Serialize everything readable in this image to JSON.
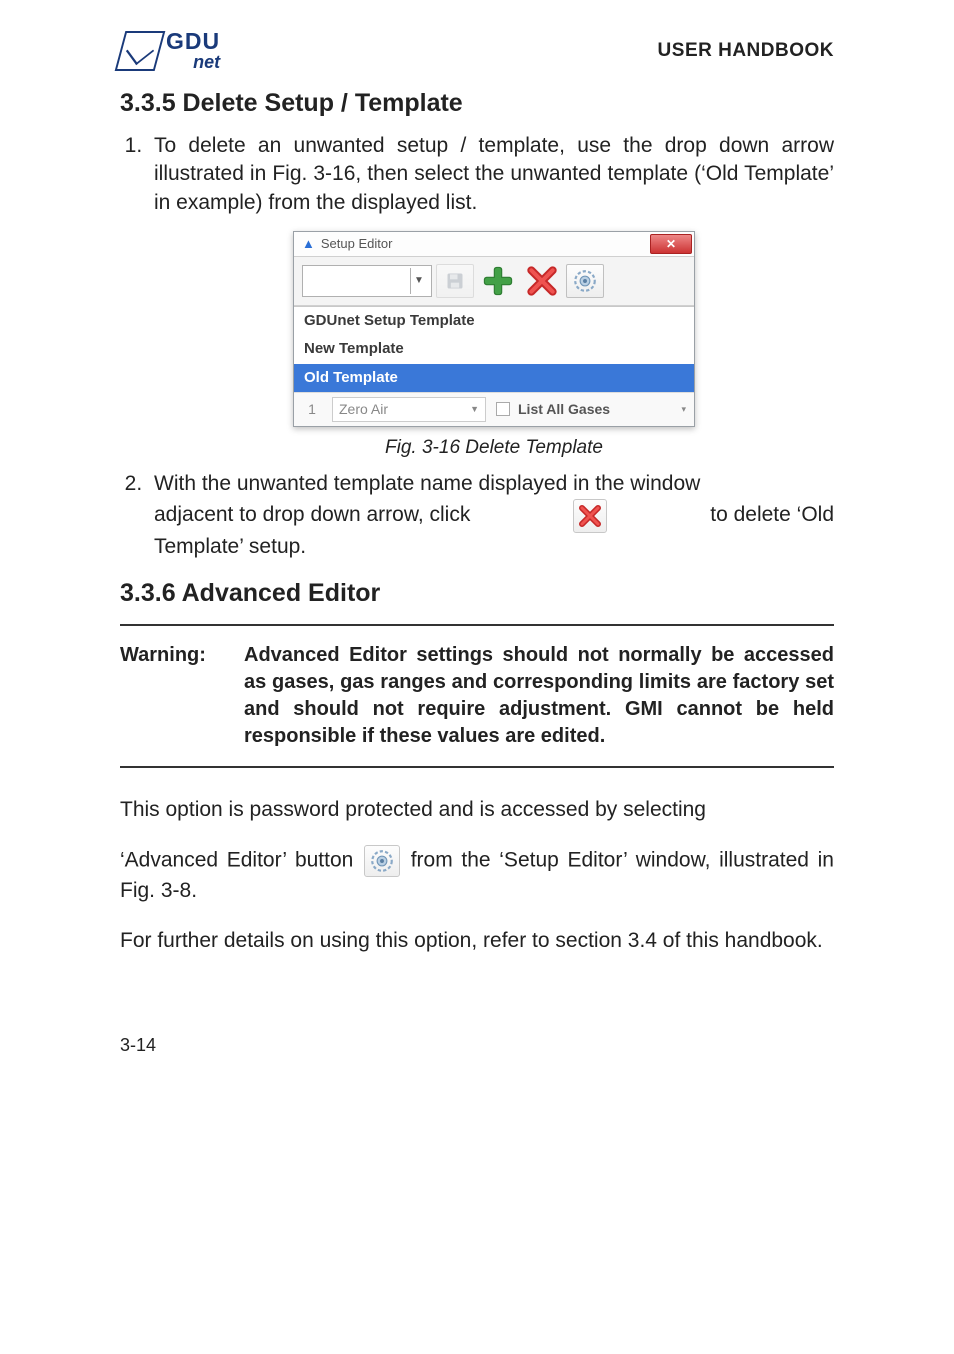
{
  "header": {
    "logo_top": "GDU",
    "logo_bottom": "net",
    "doc_title": "USER HANDBOOK"
  },
  "section_335": {
    "heading": "3.3.5  Delete Setup / Template",
    "step1": "To delete an unwanted setup / template, use the drop down arrow illustrated in Fig. 3-16, then select the unwanted template (‘Old Template’ in example) from the displayed list.",
    "fig_caption": "Fig. 3-16  Delete Template",
    "step2_line1": "With the unwanted template name displayed in the window",
    "step2_seg_a": "adjacent to drop down arrow, click",
    "step2_seg_b": "to delete ‘Old",
    "step2_line3": "Template’ setup."
  },
  "setup_editor": {
    "window_title": "Setup Editor",
    "dropdown_options": {
      "opt1": "GDUnet Setup Template",
      "opt2": "New Template",
      "opt3_selected": "Old Template"
    },
    "gas_row": {
      "index": "1",
      "gas_name": "Zero Air",
      "checkbox_label": "List All Gases"
    }
  },
  "section_336": {
    "heading": "3.3.6  Advanced Editor",
    "warning_label": "Warning:",
    "warning_body": "Advanced Editor settings should not normally be accessed as gases, gas ranges and corresponding limits are factory set and should not require adjustment. GMI cannot be held responsible if these values are edited.",
    "para1_a": "This option is password protected and is accessed by selecting",
    "para2_a": "‘Advanced Editor’ button",
    "para2_b": "from the ‘Setup Editor’ window, illustrated in Fig. 3-8.",
    "para3": "For further details on using this option, refer to section 3.4 of this handbook."
  },
  "page_number": "3-14"
}
